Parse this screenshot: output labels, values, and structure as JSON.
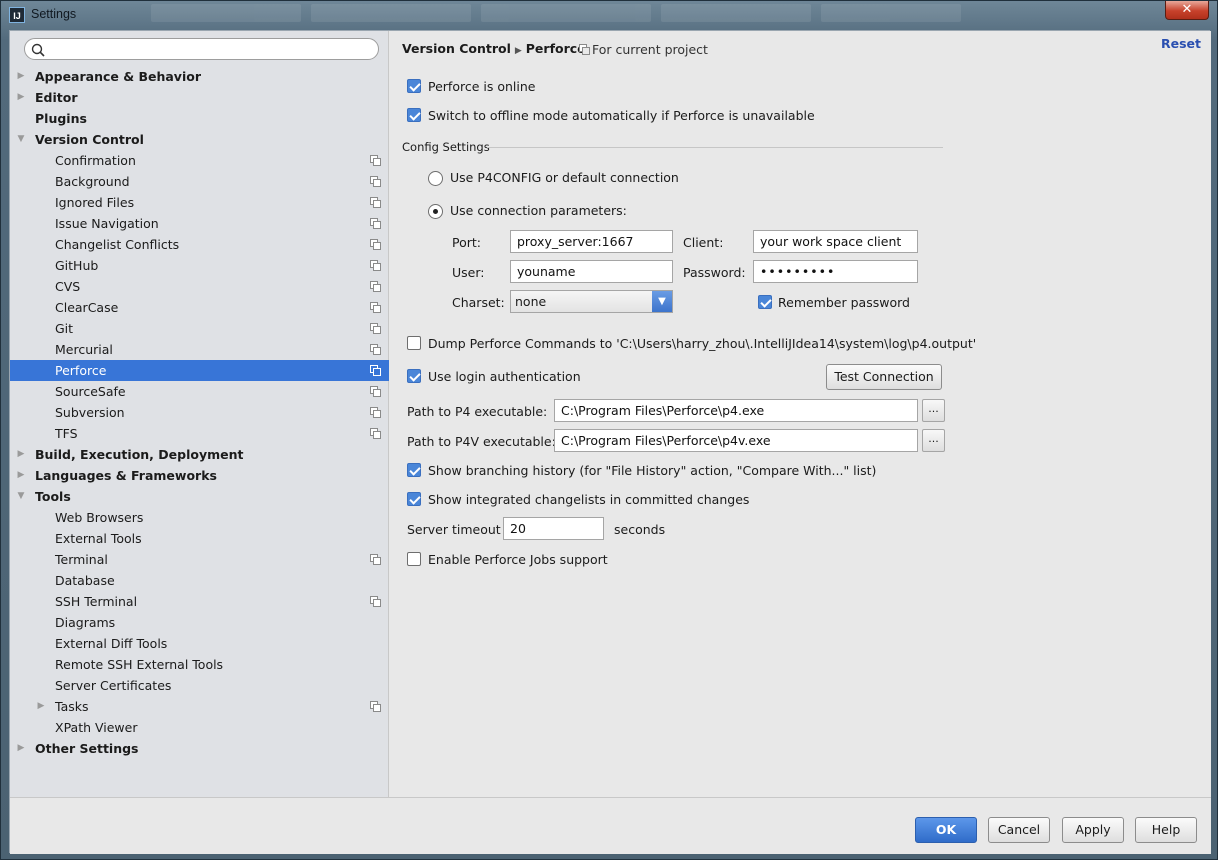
{
  "window": {
    "title": "Settings",
    "app_icon_text": "IJ",
    "close_label": "✕"
  },
  "search": {
    "placeholder": ""
  },
  "tree": [
    {
      "label": "Appearance & Behavior",
      "level": 0,
      "arrow": "▶",
      "proj": false
    },
    {
      "label": "Editor",
      "level": 0,
      "arrow": "▶",
      "proj": false
    },
    {
      "label": "Plugins",
      "level": 0,
      "arrow": "",
      "proj": false
    },
    {
      "label": "Version Control",
      "level": 0,
      "arrow": "▼",
      "proj": false
    },
    {
      "label": "Confirmation",
      "level": 1,
      "arrow": "",
      "proj": true
    },
    {
      "label": "Background",
      "level": 1,
      "arrow": "",
      "proj": true
    },
    {
      "label": "Ignored Files",
      "level": 1,
      "arrow": "",
      "proj": true
    },
    {
      "label": "Issue Navigation",
      "level": 1,
      "arrow": "",
      "proj": true
    },
    {
      "label": "Changelist Conflicts",
      "level": 1,
      "arrow": "",
      "proj": true
    },
    {
      "label": "GitHub",
      "level": 1,
      "arrow": "",
      "proj": true
    },
    {
      "label": "CVS",
      "level": 1,
      "arrow": "",
      "proj": true
    },
    {
      "label": "ClearCase",
      "level": 1,
      "arrow": "",
      "proj": true
    },
    {
      "label": "Git",
      "level": 1,
      "arrow": "",
      "proj": true
    },
    {
      "label": "Mercurial",
      "level": 1,
      "arrow": "",
      "proj": true
    },
    {
      "label": "Perforce",
      "level": 1,
      "arrow": "",
      "proj": true,
      "selected": true
    },
    {
      "label": "SourceSafe",
      "level": 1,
      "arrow": "",
      "proj": true
    },
    {
      "label": "Subversion",
      "level": 1,
      "arrow": "",
      "proj": true
    },
    {
      "label": "TFS",
      "level": 1,
      "arrow": "",
      "proj": true
    },
    {
      "label": "Build, Execution, Deployment",
      "level": 0,
      "arrow": "▶",
      "proj": false
    },
    {
      "label": "Languages & Frameworks",
      "level": 0,
      "arrow": "▶",
      "proj": false
    },
    {
      "label": "Tools",
      "level": 0,
      "arrow": "▼",
      "proj": false
    },
    {
      "label": "Web Browsers",
      "level": 1,
      "arrow": "",
      "proj": false
    },
    {
      "label": "External Tools",
      "level": 1,
      "arrow": "",
      "proj": false
    },
    {
      "label": "Terminal",
      "level": 1,
      "arrow": "",
      "proj": true
    },
    {
      "label": "Database",
      "level": 1,
      "arrow": "",
      "proj": false
    },
    {
      "label": "SSH Terminal",
      "level": 1,
      "arrow": "",
      "proj": true
    },
    {
      "label": "Diagrams",
      "level": 1,
      "arrow": "",
      "proj": false
    },
    {
      "label": "External Diff Tools",
      "level": 1,
      "arrow": "",
      "proj": false
    },
    {
      "label": "Remote SSH External Tools",
      "level": 1,
      "arrow": "",
      "proj": false
    },
    {
      "label": "Server Certificates",
      "level": 1,
      "arrow": "",
      "proj": false
    },
    {
      "label": "Tasks",
      "level": 1,
      "arrow": "▶",
      "proj": true
    },
    {
      "label": "XPath Viewer",
      "level": 1,
      "arrow": "",
      "proj": false
    },
    {
      "label": "Other Settings",
      "level": 0,
      "arrow": "▶",
      "proj": false
    }
  ],
  "header": {
    "crumb1": "Version Control",
    "separator": "▶",
    "crumb2": "Perforce",
    "scope": "For current project",
    "reset": "Reset"
  },
  "perforce_online": {
    "label": "Perforce is online",
    "checked": true
  },
  "switch_offline": {
    "label": "Switch to offline mode automatically if Perforce is unavailable",
    "checked": true
  },
  "config": {
    "section_title": "Config Settings",
    "use_p4config": "Use P4CONFIG or default connection",
    "use_params": "Use connection parameters:",
    "port_label": "Port:",
    "port_value": "proxy_server:1667",
    "client_label": "Client:",
    "client_value": "your work space client",
    "user_label": "User:",
    "user_value": "youname",
    "password_label": "Password:",
    "password_value": "•••••••••",
    "charset_label": "Charset:",
    "charset_value": "none",
    "remember_password": "Remember password"
  },
  "dump": {
    "label": "Dump Perforce Commands to 'C:\\Users\\harry_zhou\\.IntelliJIdea14\\system\\log\\p4.output'",
    "checked": false
  },
  "login_auth": {
    "label": "Use login authentication",
    "checked": true
  },
  "test_connection": "Test Connection",
  "p4_path": {
    "label": "Path to P4 executable:",
    "value": "C:\\Program Files\\Perforce\\p4.exe",
    "browse": "..."
  },
  "p4v_path": {
    "label": "Path to P4V executable:",
    "value": "C:\\Program Files\\Perforce\\p4v.exe",
    "browse": "..."
  },
  "branching_history": {
    "label": "Show branching history (for \"File History\" action, \"Compare With...\" list)",
    "checked": true
  },
  "integrated_changelists": {
    "label": "Show integrated changelists in committed changes",
    "checked": true
  },
  "server_timeout": {
    "label": "Server timeout",
    "value": "20",
    "unit": "seconds"
  },
  "jobs_support": {
    "label": "Enable Perforce Jobs support",
    "checked": false
  },
  "footer": {
    "ok": "OK",
    "cancel": "Cancel",
    "apply": "Apply",
    "help": "Help"
  },
  "colors": {
    "selection": "#3875d7",
    "accent": "#4a86d8",
    "link": "#2a4fb0"
  }
}
